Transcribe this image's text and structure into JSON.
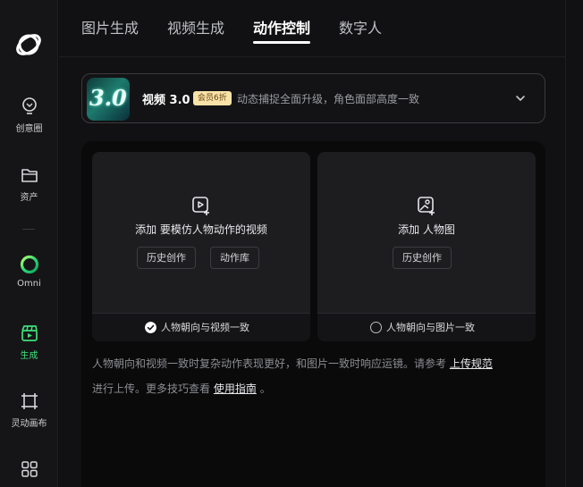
{
  "sidebar": {
    "items": [
      {
        "label": "创意圈",
        "icon": "bulb-icon"
      },
      {
        "label": "资产",
        "icon": "folder-icon"
      },
      {
        "label": "Omni",
        "icon": "omni-ring-icon"
      },
      {
        "label": "生成",
        "icon": "clapper-icon"
      },
      {
        "label": "灵动画布",
        "icon": "canvas-frame-icon"
      },
      {
        "label": "",
        "icon": "grid-apps-icon"
      }
    ],
    "active_color": "#3ee07a"
  },
  "tabs": [
    {
      "label": "图片生成"
    },
    {
      "label": "视频生成"
    },
    {
      "label": "动作控制"
    },
    {
      "label": "数字人"
    }
  ],
  "model": {
    "thumb_text": "3.0",
    "name": "视频 3.0",
    "badge": "会员6折",
    "description": "动态捕捉全面升级，角色面部高度一致"
  },
  "cards": {
    "video": {
      "title": "添加 要模仿人物动作的视频",
      "history_button": "历史创作",
      "library_button": "动作库",
      "orientation_label": "人物朝向与视频一致"
    },
    "image": {
      "title": "添加 人物图",
      "history_button": "历史创作",
      "orientation_label": "人物朝向与图片一致"
    }
  },
  "hint": {
    "line1_text": "人物朝向和视频一致时复杂动作表现更好，和图片一致时响应运镜。请参考",
    "line1_link": "上传规范",
    "line2_text": "进行上传。更多技巧查看",
    "line2_link": "使用指南",
    "line2_end": "。"
  }
}
